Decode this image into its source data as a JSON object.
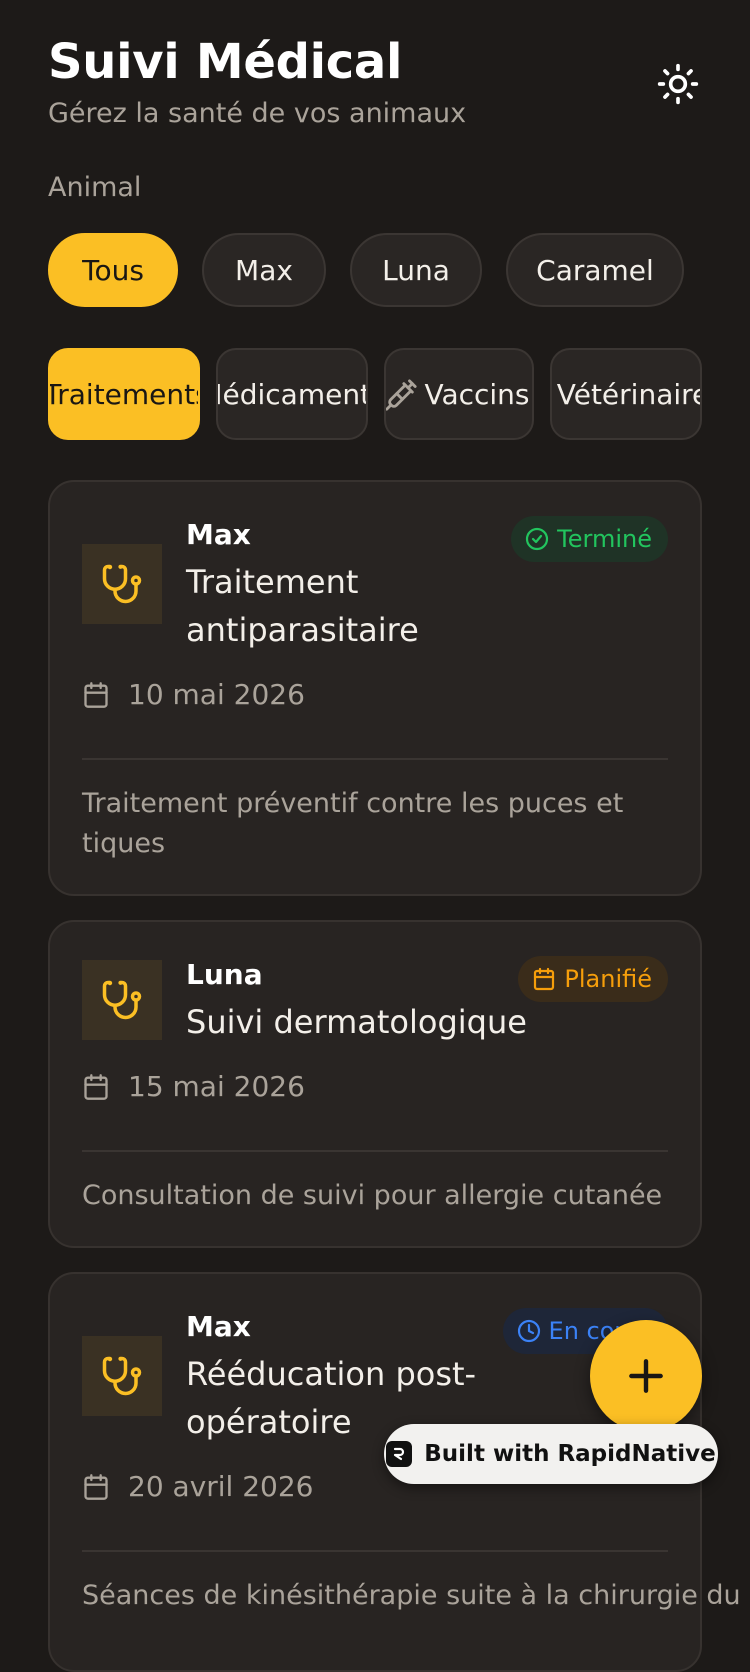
{
  "header": {
    "title": "Suivi Médical",
    "subtitle": "Gérez la santé de vos animaux",
    "theme_icon": "sun-icon"
  },
  "filters": {
    "label": "Animal",
    "chips": [
      "Tous",
      "Max",
      "Luna",
      "Caramel"
    ],
    "selected": "Tous"
  },
  "tabs": {
    "items": [
      "Traitements",
      "Médicaments",
      "Vaccins",
      "Vétérinaire"
    ],
    "selected": "Traitements"
  },
  "records": [
    {
      "pet": "Max",
      "title": "Traitement antiparasitaire",
      "date": "10 mai 2026",
      "status": "Terminé",
      "status_icon": "check-circle-icon",
      "status_color": "#22c55e",
      "description": "Traitement préventif contre les puces et tiques"
    },
    {
      "pet": "Luna",
      "title": "Suivi dermatologique",
      "date": "15 mai 2026",
      "status": "Planifié",
      "status_icon": "calendar-icon",
      "status_color": "#f59e0b",
      "description": "Consultation de suivi pour allergie cutanée"
    },
    {
      "pet": "Max",
      "title": "Rééducation post-opératoire",
      "date": "20 avril 2026",
      "status": "En cours",
      "status_icon": "clock-icon",
      "status_color": "#3b82f6",
      "description": "Séances de kinésithérapie suite à la chirurgie du"
    }
  ],
  "fab": {
    "icon": "plus-icon"
  },
  "branding": {
    "label": "Built with RapidNative"
  },
  "colors": {
    "accent": "#fbbf24",
    "background": "#1d1a18",
    "card": "#282422"
  }
}
